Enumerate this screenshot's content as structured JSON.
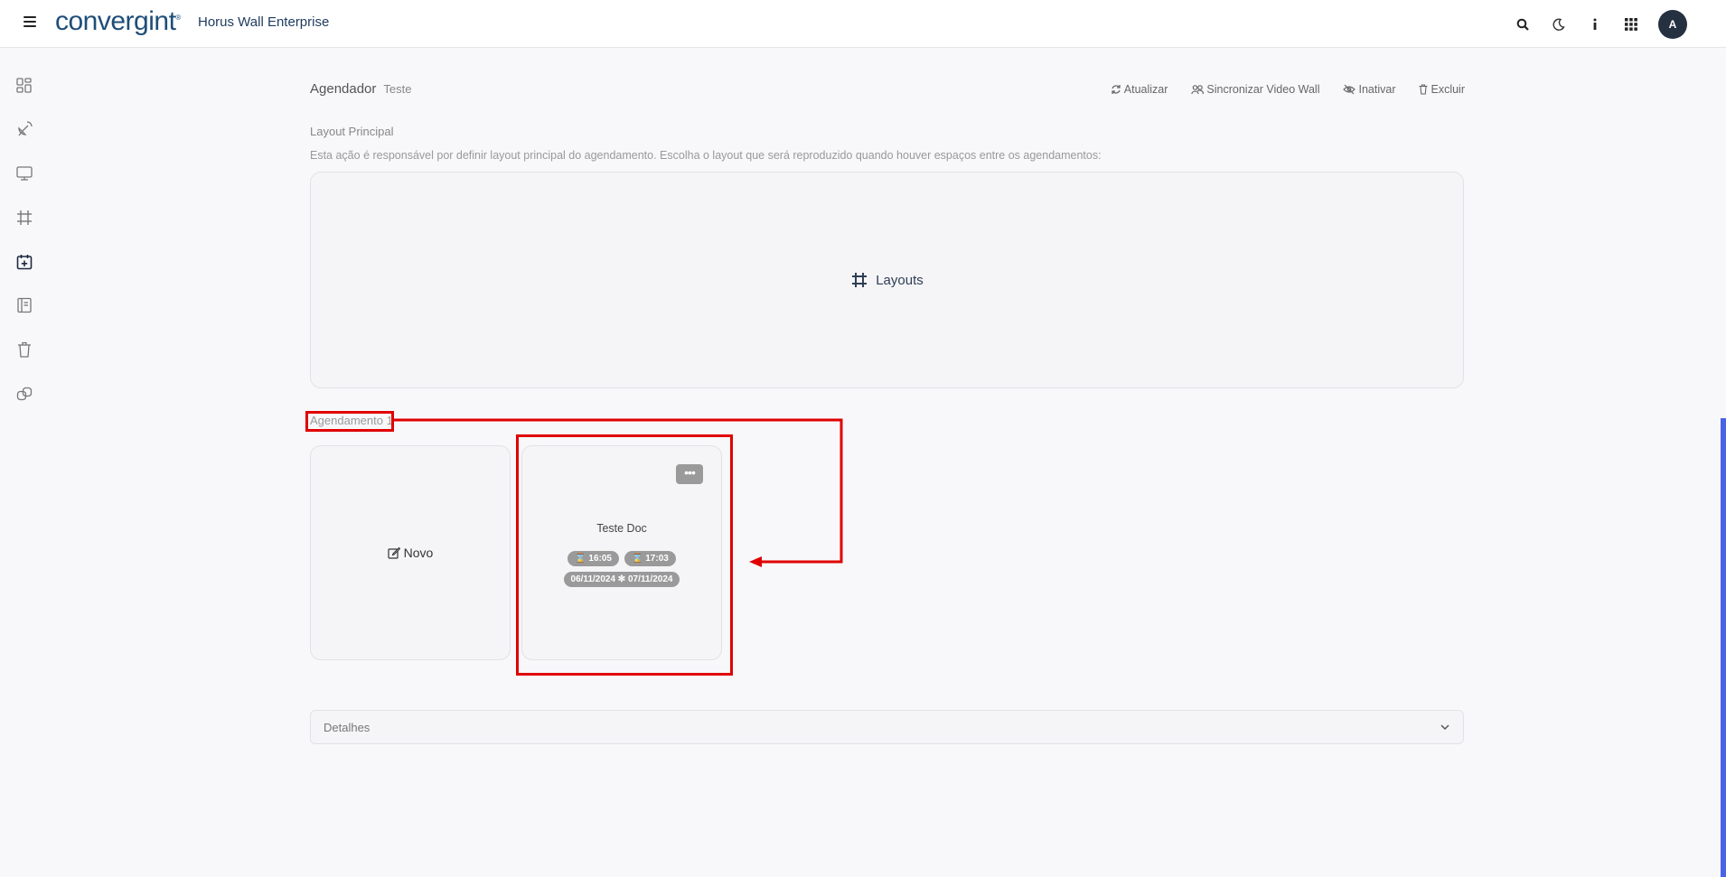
{
  "topbar": {
    "logo": "convergint",
    "logo_mark": "®",
    "app_title": "Horus Wall Enterprise",
    "avatar": "A",
    "icons": [
      "search-icon",
      "moon-icon",
      "info-icon",
      "apps-grid-icon"
    ]
  },
  "sidebar": {
    "items": [
      "dashboard-icon",
      "satellite-icon",
      "monitor-icon",
      "layout-frame-icon",
      "calendar-add-icon",
      "book-icon",
      "trash-icon",
      "link-icon"
    ],
    "active_index": 4
  },
  "header": {
    "title": "Agendador",
    "subtitle": "Teste"
  },
  "actions": {
    "refresh": "Atualizar",
    "sync": "Sincronizar Video Wall",
    "deactivate": "Inativar",
    "delete": "Excluir"
  },
  "layout_section": {
    "label": "Layout Principal",
    "description": "Esta ação é responsável por definir layout principal do agendamento. Escolha o layout que será reproduzido quando houver espaços entre os agendamentos:",
    "button": "Layouts"
  },
  "schedule": {
    "label": "Agendamento 1",
    "new_label": "Novo",
    "card": {
      "title": "Teste Doc",
      "start_time": "16:05",
      "end_time": "17:03",
      "start_date": "06/11/2024",
      "end_date": "07/11/2024",
      "menu": "•••"
    }
  },
  "details": {
    "label": "Detalhes"
  },
  "colors": {
    "highlight": "#e00000",
    "brand": "#1f4e79",
    "scrollbar": "#4a63e6"
  }
}
